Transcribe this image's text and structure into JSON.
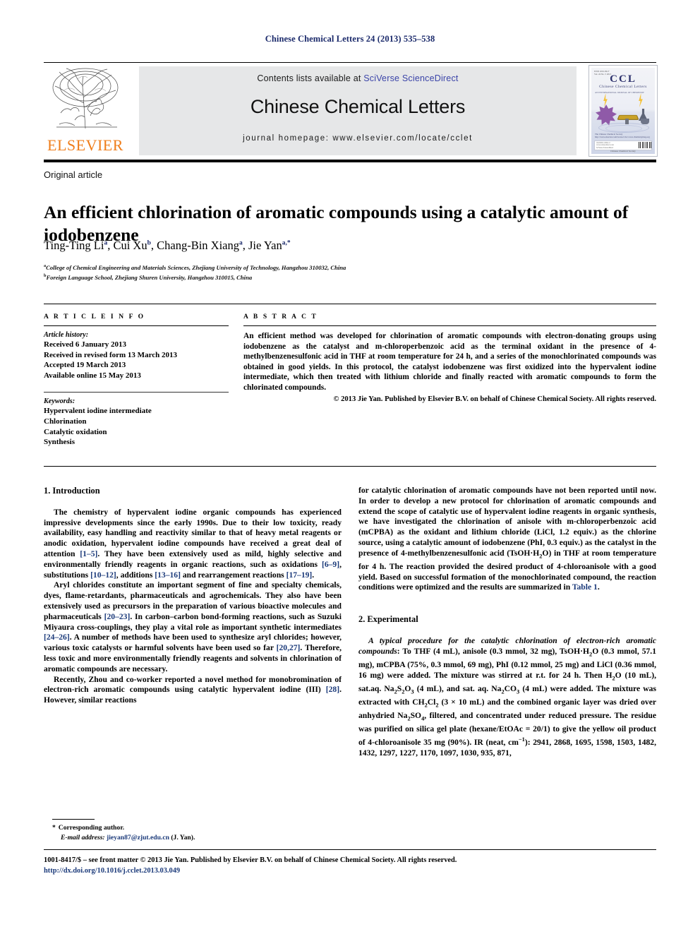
{
  "running_head": "Chinese Chemical Letters 24 (2013) 535–538",
  "masthead": {
    "publisher_logo_label": "ELSEVIER",
    "contents_prefix": "Contents lists available at ",
    "contents_link": "SciVerse ScienceDirect",
    "journal_name": "Chinese Chemical Letters",
    "homepage": "journal homepage: www.elsevier.com/locate/cclet",
    "cover": {
      "title": "CCL",
      "subtitle": "Chinese Chemical Letters",
      "meta": "ISSN 1001-8417\nVol. 24  No. 5  2013",
      "tagline": "AN INTERNATIONAL JOURNAL OF CHEMISTRY",
      "caption": "The Chinese Chemical Society\nhttp://www.elsevier.com/locate/cclet      www.chemistrymag.org",
      "barbox": "Available online at\nwww.sciencedirect.com\nSciVerse ScienceDirect",
      "footer": "Chinese Chemical Society"
    }
  },
  "article": {
    "kind": "Original article",
    "title": "An efficient chlorination of aromatic compounds using a catalytic amount of iodobenzene",
    "authors": [
      {
        "name": "Ting-Ting Li",
        "marks": "a"
      },
      {
        "name": "Cui Xu",
        "marks": "b"
      },
      {
        "name": "Chang-Bin Xiang",
        "marks": "a"
      },
      {
        "name": "Jie Yan",
        "marks": "a,*"
      }
    ],
    "affiliations": [
      {
        "mark": "a",
        "text": "College of Chemical Engineering and Materials Sciences, Zhejiang University of Technology, Hangzhou 310032, China"
      },
      {
        "mark": "b",
        "text": "Foreign Language School, Zhejiang Shuren University, Hangzhou 310015, China"
      }
    ]
  },
  "info": {
    "heading": "A R T I C L E  I N F O",
    "history_label": "Article history:",
    "history": [
      "Received 6 January 2013",
      "Received in revised form 13 March 2013",
      "Accepted 19 March 2013",
      "Available online 15 May 2013"
    ],
    "keywords_label": "Keywords:",
    "keywords": [
      "Hypervalent iodine intermediate",
      "Chlorination",
      "Catalytic oxidation",
      "Synthesis"
    ]
  },
  "abstract": {
    "heading": "A B S T R A C T",
    "text": "An efficient method was developed for chlorination of aromatic compounds with electron-donating groups using iodobenzene as the catalyst and m-chloroperbenzoic acid as the terminal oxidant in the presence of 4-methylbenzenesulfonic acid in THF at room temperature for 24 h, and a series of the monochlorinated compounds was obtained in good yields. In this protocol, the catalyst iodobenzene was first oxidized into the hypervalent iodine intermediate, which then treated with lithium chloride and finally reacted with aromatic compounds to form the chlorinated compounds.",
    "copyright": "© 2013 Jie Yan. Published by Elsevier B.V. on behalf of Chinese Chemical Society. All rights reserved."
  },
  "body": {
    "section1_heading": "1. Introduction",
    "section2_heading": "2. Experimental",
    "left_paragraphs": [
      "The chemistry of hypervalent iodine organic compounds has experienced impressive developments since the early 1990s. Due to their low toxicity, ready availability, easy handling and reactivity similar to that of heavy metal reagents or anodic oxidation, hypervalent iodine compounds have received a great deal of attention [1–5]. They have been extensively used as mild, highly selective and environmentally friendly reagents in organic reactions, such as oxidations [6–9], substitutions [10–12], additions [13–16] and rearrangement reactions [17–19].",
      "Aryl chlorides constitute an important segment of fine and specialty chemicals, dyes, flame-retardants, pharmaceuticals and agrochemicals. They also have been extensively used as precursors in the preparation of various bioactive molecules and pharmaceuticals [20–23]. In carbon–carbon bond-forming reactions, such as Suzuki Miyaura cross-couplings, they play a vital role as important synthetic intermediates [24–26]. A number of methods have been used to synthesize aryl chlorides; however, various toxic catalysts or harmful solvents have been used so far [20,27]. Therefore, less toxic and more environmentally friendly reagents and solvents in chlorination of aromatic compounds are necessary.",
      "Recently, Zhou and co-worker reported a novel method for monobromination of electron-rich aromatic compounds using catalytic hypervalent iodine (III) [28]. However, similar reactions"
    ],
    "right_paragraph_continued": "for catalytic chlorination of aromatic compounds have not been reported until now. In order to develop a new protocol for chlorination of aromatic compounds and extend the scope of catalytic use of hypervalent iodine reagents in organic synthesis, we have investigated the chlorination of anisole with m-chloroperbenzoic acid (mCPBA) as the oxidant and lithium chloride (LiCl, 1.2 equiv.) as the chlorine source, using a catalytic amount of iodobenzene (PhI, 0.3 equiv.) as the catalyst in the presence of 4-methylbenzenesulfonic acid (TsOH·H2O) in THF at room temperature for 4 h. The reaction provided the desired product of 4-chloroanisole with a good yield. Based on successful formation of the monochlorinated compound, the reaction conditions were optimized and the results are summarized in Table 1.",
    "table_link": "Table 1",
    "experimental_paragraph": "A typical procedure for the catalytic chlorination of electron-rich aromatic compounds: To THF (4 mL), anisole (0.3 mmol, 32 mg), TsOH·H2O (0.3 mmol, 57.1 mg), mCPBA (75%, 0.3 mmol, 69 mg), PhI (0.12 mmol, 25 mg) and LiCl (0.36 mmol, 16 mg) were added. The mixture was stirred at r.t. for 24 h. Then H2O (10 mL), sat.aq. Na2S2O3 (4 mL), and sat. aq. Na2CO3 (4 mL) were added. The mixture was extracted with CH2Cl2 (3 × 10 mL) and the combined organic layer was dried over anhydried Na2SO4, filtered, and concentrated under reduced pressure. The residue was purified on silica gel plate (hexane/EtOAc = 20/1) to give the yellow oil product of 4-chloroanisole 35 mg (90%). IR (neat, cm−1): 2941, 2868, 1695, 1598, 1503, 1482, 1432, 1297, 1227, 1170, 1097, 1030, 935, 871,",
    "experimental_italic_lead": "A typical procedure for the catalytic chlorination of electron-rich aromatic compounds"
  },
  "footnote": {
    "star": "*",
    "corresponding": "Corresponding author.",
    "email_label": "E-mail address:",
    "email": "jieyan87@zjut.edu.cn",
    "email_owner": "(J. Yan)."
  },
  "page_footer": {
    "line1": "1001-8417/$ – see front matter © 2013 Jie Yan. Published by Elsevier B.V. on behalf of Chinese Chemical Society. All rights reserved.",
    "doi": "http://dx.doi.org/10.1016/j.cclet.2013.03.049"
  },
  "colors": {
    "running_head": "#1b2a6b",
    "link": "#1b3a7a",
    "elsevier_orange": "#ef7d1a",
    "band_gray": "#e6e7e8"
  }
}
